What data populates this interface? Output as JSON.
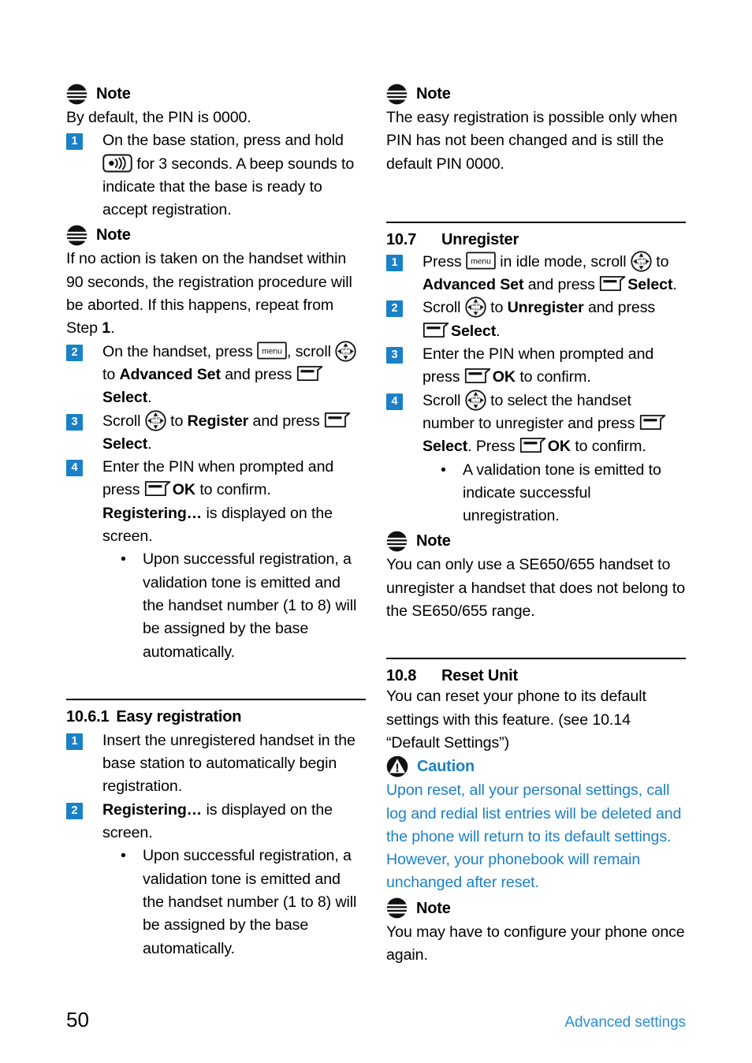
{
  "page": {
    "number": "50",
    "footer_section": "Advanced settings",
    "accent_blue": "#1a80c8",
    "footer_blue": "#2b8fd6"
  },
  "left_column": {
    "note1": {
      "icon": "note-icon",
      "label": "Note",
      "text": "By default, the PIN is 0000."
    },
    "step1": {
      "num": "1",
      "text_a": "On the base station, press and hold",
      "icon": "paging-key-icon",
      "text_b": "for 3 seconds. A beep sounds to indicate that the base is ready to accept registration."
    },
    "note2": {
      "icon": "note-icon",
      "label": "Note",
      "text_a": "If no action is taken on the handset within 90 seconds, the registration procedure will be aborted. If this happens, repeat from Step ",
      "bold_b": "1",
      "text_c": "."
    },
    "step2": {
      "num": "2",
      "t1": "On the handset, press ",
      "icon_menu": "menu-key-icon",
      "t2": ", scroll ",
      "icon_nav": "navigation-key-icon",
      "t3": " to ",
      "b1": "Advanced Set",
      "t4": " and press ",
      "icon_soft": "softkey-icon",
      "b2": "Select",
      "t5": "."
    },
    "step3": {
      "num": "3",
      "t1": "Scroll ",
      "icon_nav": "navigation-key-icon",
      "t2": " to ",
      "b1": "Register",
      "t3": " and press ",
      "icon_soft": "softkey-icon",
      "b2": "Select",
      "t4": "."
    },
    "step4": {
      "num": "4",
      "t1": "Enter the PIN when prompted and press ",
      "icon_soft": "softkey-icon",
      "b1": "OK",
      "t2": " to confirm. ",
      "b2": "Registering…",
      "t3": " is displayed on the screen."
    },
    "step4_bullet": {
      "dot": "•",
      "text": "Upon successful registration, a validation tone is emitted and the handset number (1 to 8) will be assigned by the base automatically."
    },
    "section_1061": {
      "number": "10.6.1",
      "title": "Easy registration"
    },
    "easy_step1": {
      "num": "1",
      "text": "Insert the unregistered handset in the base station to automatically begin registration."
    },
    "easy_step2": {
      "num": "2",
      "b1": "Registering…",
      "t1": " is displayed on the screen."
    },
    "easy_bullet": {
      "dot": "•",
      "text": "Upon successful registration, a validation tone is emitted and the handset number (1 to 8) will be assigned by the base automatically."
    }
  },
  "right_column": {
    "note1": {
      "icon": "note-icon",
      "label": "Note",
      "text": "The easy registration is possible only when PIN has not been changed and is still the default PIN 0000."
    },
    "section_107": {
      "number": "10.7",
      "title": "Unregister"
    },
    "unreg_step1": {
      "num": "1",
      "t1": "Press ",
      "icon_menu": "menu-key-icon",
      "t2": " in idle mode, scroll ",
      "icon_nav": "navigation-key-icon",
      "t3": " to ",
      "b1": "Advanced Set",
      "t4": " and press ",
      "icon_soft": "softkey-icon",
      "b2": "Select",
      "t5": "."
    },
    "unreg_step2": {
      "num": "2",
      "t1": "Scroll ",
      "icon_nav": "navigation-key-icon",
      "t2": " to ",
      "b1": "Unregister",
      "t3": " and press ",
      "icon_soft": "softkey-icon",
      "b2": "Select",
      "t4": "."
    },
    "unreg_step3": {
      "num": "3",
      "t1": "Enter the PIN when prompted and press ",
      "icon_soft": "softkey-icon",
      "b1": "OK",
      "t2": " to confirm."
    },
    "unreg_step4": {
      "num": "4",
      "t1": "Scroll ",
      "icon_nav": "navigation-key-icon",
      "t2": " to select the handset number to unregister and press ",
      "icon_soft": "softkey-icon",
      "b1": "Select",
      "t3": ". Press ",
      "icon_soft2": "softkey-icon",
      "b2": "OK",
      "t4": " to confirm."
    },
    "unreg_bullet": {
      "dot": "•",
      "text": "A validation tone is emitted to indicate successful unregistration."
    },
    "note2": {
      "icon": "note-icon",
      "label": "Note",
      "text": "You can only use a SE650/655 handset to unregister a handset that does not belong to the SE650/655 range."
    },
    "section_108": {
      "number": "10.8",
      "title": "Reset Unit"
    },
    "reset_intro": "You can reset your phone to its default settings with this feature. (see 10.14 “Default Settings”)",
    "caution": {
      "icon": "caution-icon",
      "label": "Caution",
      "text": "Upon reset, all your personal settings, call log and redial list entries will be deleted and the phone will return to its default settings. However, your phonebook will remain unchanged after reset."
    },
    "note3": {
      "icon": "note-icon",
      "label": "Note",
      "text": "You may have to configure your phone once again."
    }
  }
}
